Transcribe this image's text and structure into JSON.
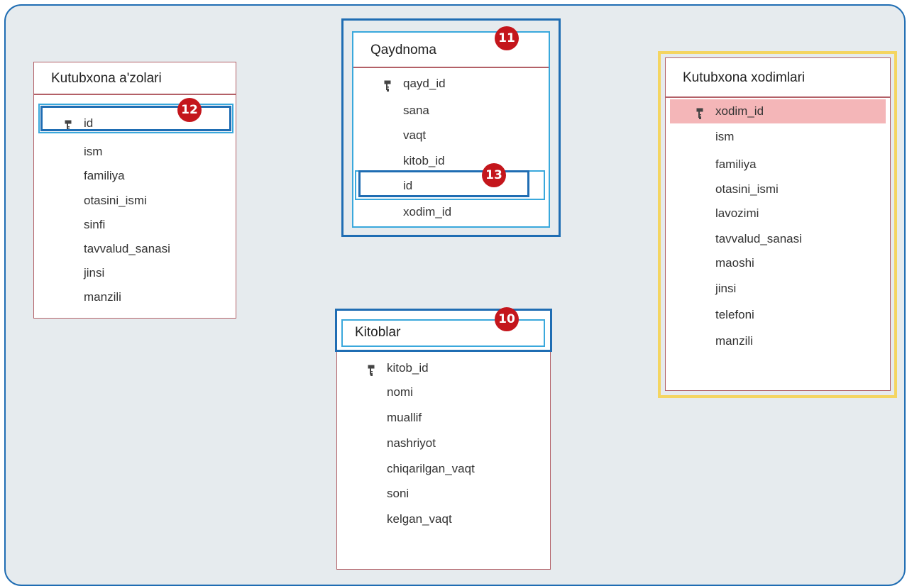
{
  "tables": {
    "members": {
      "title": "Kutubxona a'zolari",
      "fields": [
        "id",
        "ism",
        "familiya",
        "otasini_ismi",
        "sinfi",
        "tavvalud_sanasi",
        "jinsi",
        "manzili"
      ],
      "primary_key": "id"
    },
    "log": {
      "title": "Qaydnoma",
      "fields": [
        "qayd_id",
        "sana",
        "vaqt",
        "kitob_id",
        "id",
        "xodim_id"
      ],
      "primary_key": "qayd_id"
    },
    "staff": {
      "title": "Kutubxona xodimlari",
      "fields": [
        "xodim_id",
        "ism",
        "familiya",
        "otasini_ismi",
        "lavozimi",
        "tavvalud_sanasi",
        "maoshi",
        "jinsi",
        "telefoni",
        "manzili"
      ],
      "primary_key": "xodim_id",
      "selected_field": "xodim_id"
    },
    "books": {
      "title": "Kitoblar",
      "fields": [
        "kitob_id",
        "nomi",
        "muallif",
        "nashriyot",
        "chiqarilgan_vaqt",
        "soni",
        "kelgan_vaqt"
      ],
      "primary_key": "kitob_id"
    }
  },
  "badges": {
    "b10": "10",
    "b11": "11",
    "b12": "12",
    "b13": "13"
  },
  "colors": {
    "badge": "#c4161c",
    "highlight_dark": "#1f6db3",
    "highlight_light": "#3aa8dc",
    "selected_row": "#f4b6b8",
    "table_border": "#b36067",
    "staff_frame": "#f4d561"
  }
}
